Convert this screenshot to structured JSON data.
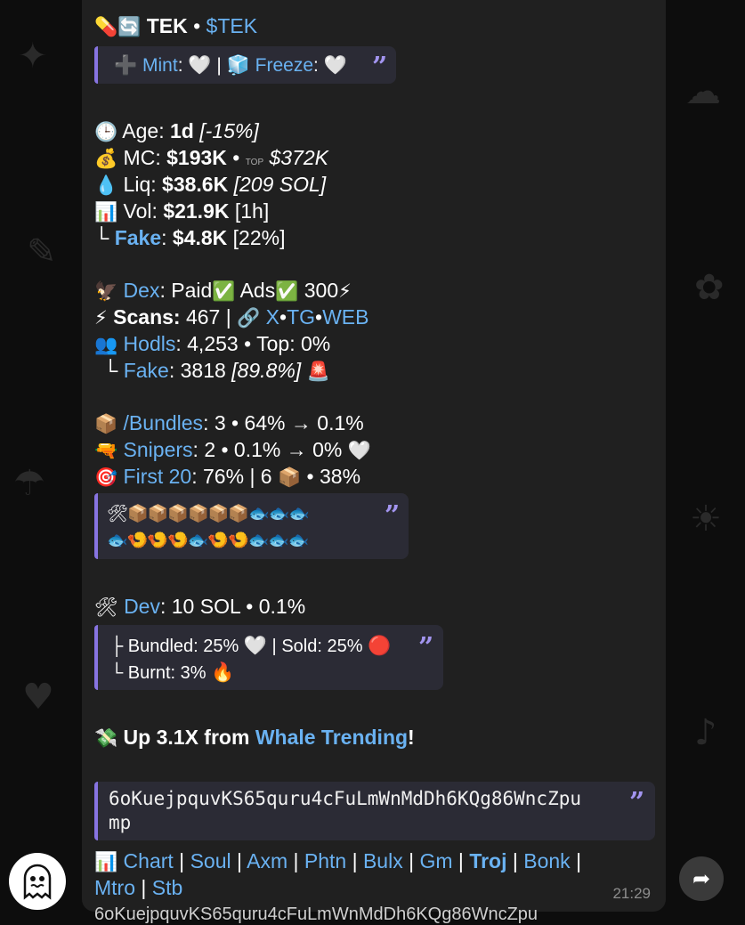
{
  "header": {
    "title": "TEK",
    "sep": "•",
    "ticker": "$TEK"
  },
  "mint_freeze": {
    "mint_label": "Mint",
    "mint_status": "🤍",
    "divider": "|",
    "freeze_label": "Freeze",
    "freeze_status": "🤍"
  },
  "stats": {
    "age_label": "Age:",
    "age_value": "1d",
    "age_change": "[-15%]",
    "mc_label": "MC:",
    "mc_value": "$193K",
    "mc_top_tag": "TOP",
    "mc_top": "$372K",
    "liq_label": "Liq:",
    "liq_value": "$38.6K",
    "liq_sol": "[209 SOL]",
    "vol_label": "Vol:",
    "vol_value": "$21.9K",
    "vol_period": "[1h]",
    "fake_label": "Fake",
    "fake_value": "$4.8K",
    "fake_pct": "[22%]"
  },
  "dex": {
    "dex_label": "Dex",
    "paid_label": "Paid",
    "ads_label": "Ads",
    "boost": "300",
    "scans_label": "Scans:",
    "scans_value": "467",
    "link_x": "X",
    "link_tg": "TG",
    "link_web": "WEB",
    "hodls_label": "Hodls",
    "hodls_value": "4,253",
    "top_label": "Top: 0%",
    "fake_label": "Fake",
    "fake_count": "3818",
    "fake_pct": "[89.8%]"
  },
  "bundles": {
    "bundles_label": "/Bundles",
    "bundles_value": "3 • 64% → 0.1%",
    "snipers_label": "Snipers",
    "snipers_value": "2 • 0.1% → 0%",
    "first20_label": "First 20",
    "first20_value": "76% | 6",
    "first20_pct": "• 38%",
    "holders_row1": "🛠📦📦📦📦📦📦🐟🐟🐟",
    "holders_row2": "🐟🍤🍤🍤🐟🍤🍤🐟🐟🐟"
  },
  "dev": {
    "dev_label": "Dev",
    "dev_value": "10 SOL • 0.1%",
    "bundled": "Bundled: 25%",
    "sold": "Sold: 25%",
    "burnt": "Burnt: 3%"
  },
  "promo": {
    "prefix": "Up 3.1X from",
    "link": "Whale Trending",
    "suffix": "!"
  },
  "contract": {
    "address_line1": "6oKuejpquvKS65quru4cFuLmWnMdDh6KQg86WncZpu",
    "address_line2": "mp"
  },
  "links": [
    "Chart",
    "Soul",
    "Axm",
    "Phtn",
    "Bulx",
    "Gm",
    "Troj",
    "Bonk",
    "Mtro",
    "Stb"
  ],
  "message_time": "21:29",
  "next_message_peek": "6oKuejpquvKS65quru4cFuLmWnMdDh6KQg86WncZpu",
  "colors": {
    "link": "#6ab2f2",
    "quote_bar": "#8774e1",
    "bubble": "#202020"
  }
}
